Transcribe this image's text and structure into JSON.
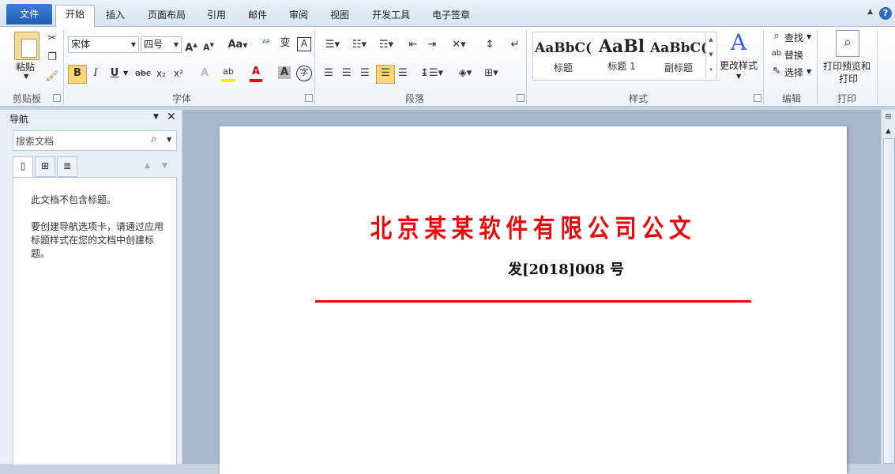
{
  "tabs": {
    "file": "文件",
    "items": [
      "开始",
      "插入",
      "页面布局",
      "引用",
      "邮件",
      "审阅",
      "视图",
      "开发工具",
      "电子签章"
    ],
    "active": "开始"
  },
  "ribbon": {
    "clipboard": {
      "paste": "粘贴",
      "group": "剪贴板"
    },
    "font": {
      "name": "宋体",
      "size": "四号",
      "group": "字体",
      "change_case": "Aa",
      "bold": "B",
      "italic": "I",
      "underline": "U",
      "strike": "abc",
      "sub": "x₂",
      "sup": "x²",
      "color_a": "A"
    },
    "paragraph": {
      "group": "段落"
    },
    "styles": {
      "items": [
        {
          "sample": "AaBbC(",
          "name": "标题"
        },
        {
          "sample": "AaBl",
          "name": "标题 1"
        },
        {
          "sample": "AaBbC(",
          "name": "副标题"
        }
      ],
      "change": "更改样式",
      "group": "样式"
    },
    "editing": {
      "find": "查找",
      "replace": "替换",
      "select": "选择",
      "group": "编辑"
    },
    "print": {
      "preview": "打印预览和",
      "preview2": "打印",
      "group": "打印"
    }
  },
  "nav": {
    "title": "导航",
    "search_placeholder": "搜索文档",
    "msg1": "此文档不包含标题。",
    "msg2": "要创建导航选项卡，请通过应用标题样式在您的文档中创建标题。"
  },
  "document": {
    "title": "北京某某软件有限公司公文",
    "number": "发[2018]008 号",
    "accent_color": "#e8080c"
  }
}
